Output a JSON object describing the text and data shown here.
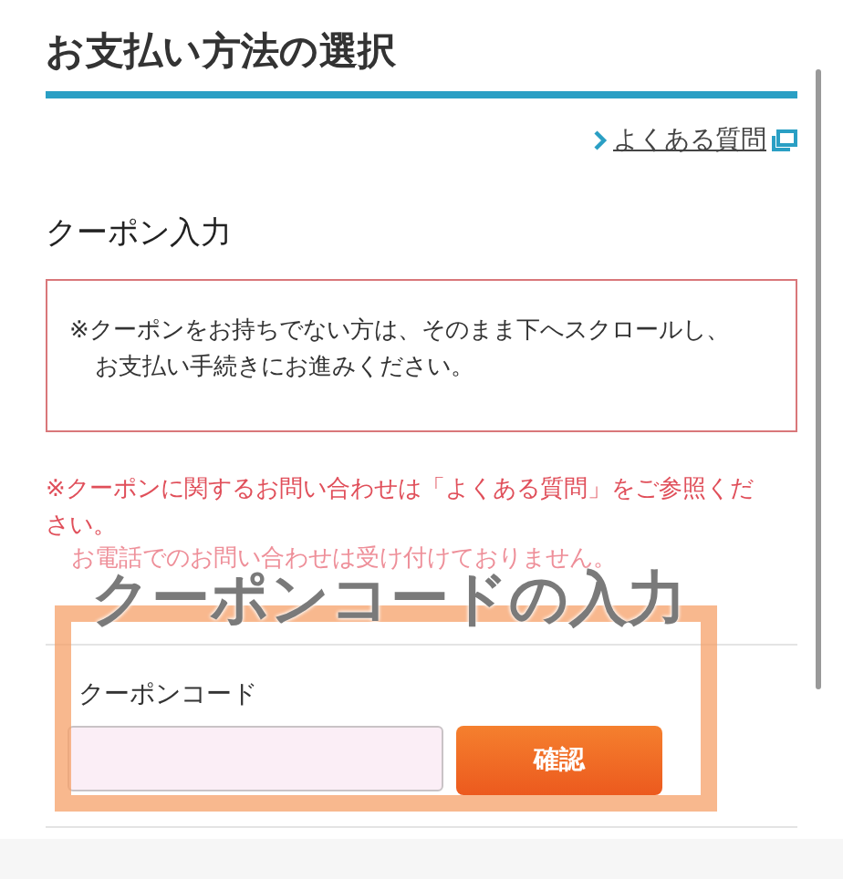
{
  "header": {
    "title": "お支払い方法の選択"
  },
  "faq_link": {
    "label": "よくある質問"
  },
  "section": {
    "title": "クーポン入力"
  },
  "notice_box": {
    "lines": [
      "※クーポンをお持ちでない方は、そのまま下へスクロールし、",
      "お支払い手続きにお進みください。"
    ]
  },
  "warning": {
    "lines": [
      "※クーポンに関するお問い合わせは「よくある質問」をご参照ください。",
      "お電話でのお問い合わせは受け付けておりません。"
    ]
  },
  "coupon_form": {
    "label": "クーポンコード",
    "button": "確認"
  },
  "annotation": {
    "caption": "クーポンコードの入力"
  }
}
